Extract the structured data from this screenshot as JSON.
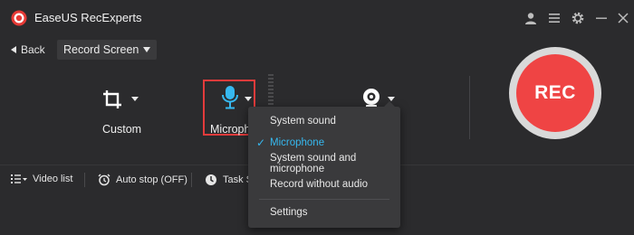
{
  "app": {
    "title": "EaseUS RecExperts",
    "logo_icon": "easeus-record-logo-icon",
    "accent_color": "#ef4444",
    "highlight_color": "#36b8ef"
  },
  "titlebar": {
    "icons": [
      "user-icon",
      "menu-icon",
      "gear-icon",
      "minimize-icon",
      "close-icon"
    ]
  },
  "header": {
    "back_label": "Back",
    "mode_select": "Record Screen"
  },
  "tools": {
    "region": {
      "label": "Custom",
      "icon": "crop-icon"
    },
    "audio": {
      "label": "Microphone",
      "icon": "microphone-icon"
    },
    "webcam": {
      "icon": "webcam-icon"
    }
  },
  "record_button": {
    "label": "REC"
  },
  "bottombar": {
    "video_list": "Video list",
    "auto_stop": "Auto stop (OFF)",
    "task_scheduler": "Task S"
  },
  "audio_menu": {
    "items": [
      {
        "label": "System sound",
        "selected": false
      },
      {
        "label": "Microphone",
        "selected": true
      },
      {
        "label": "System sound and microphone",
        "selected": false
      },
      {
        "label": "Record without audio",
        "selected": false
      }
    ],
    "settings_label": "Settings",
    "check_glyph": "✓"
  }
}
